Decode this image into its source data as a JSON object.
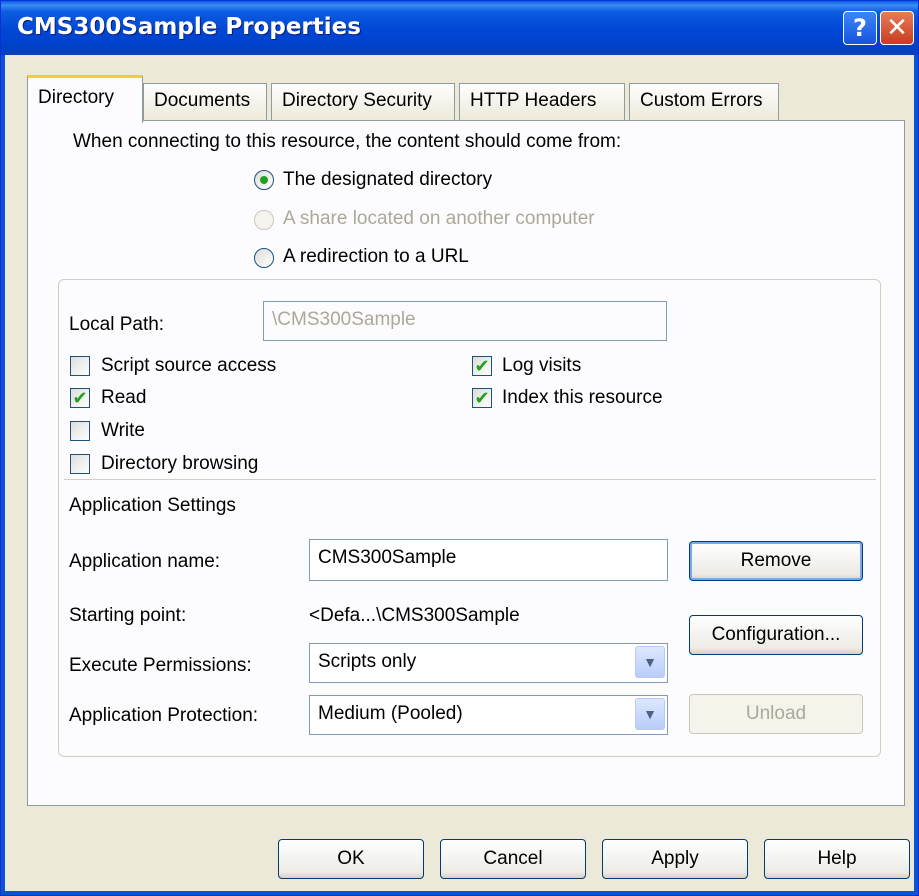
{
  "window": {
    "title": "CMS300Sample Properties",
    "help_glyph": "?",
    "close_glyph": "✕"
  },
  "tabs": [
    {
      "label": "Directory",
      "active": true
    },
    {
      "label": "Documents",
      "active": false
    },
    {
      "label": "Directory Security",
      "active": false
    },
    {
      "label": "HTTP Headers",
      "active": false
    },
    {
      "label": "Custom Errors",
      "active": false
    }
  ],
  "content_source": {
    "prompt": "When connecting to this resource, the content should come from:",
    "options": [
      {
        "label": "The designated directory",
        "selected": true,
        "enabled": true
      },
      {
        "label": "A share located on another computer",
        "selected": false,
        "enabled": false
      },
      {
        "label": "A redirection to a URL",
        "selected": false,
        "enabled": true
      }
    ]
  },
  "local_path": {
    "label": "Local Path:",
    "value": "\\CMS300Sample"
  },
  "checkboxes": {
    "script_source_access": {
      "label": "Script source access",
      "checked": false
    },
    "read": {
      "label": "Read",
      "checked": true
    },
    "write": {
      "label": "Write",
      "checked": false
    },
    "directory_browsing": {
      "label": "Directory browsing",
      "checked": false
    },
    "log_visits": {
      "label": "Log visits",
      "checked": true
    },
    "index_resource": {
      "label": "Index this resource",
      "checked": true
    }
  },
  "app_settings": {
    "heading": "Application Settings",
    "name_label": "Application name:",
    "name_value": "CMS300Sample",
    "starting_point_label": "Starting point:",
    "starting_point_value": "<Defa...\\CMS300Sample",
    "exec_perm_label": "Execute Permissions:",
    "exec_perm_value": "Scripts only",
    "protection_label": "Application Protection:",
    "protection_value": "Medium (Pooled)",
    "remove_label": "Remove",
    "configuration_label": "Configuration...",
    "unload_label": "Unload"
  },
  "footer": {
    "ok": "OK",
    "cancel": "Cancel",
    "apply": "Apply",
    "help": "Help"
  },
  "check_glyph": "✔",
  "dropdown_glyph": "▼"
}
